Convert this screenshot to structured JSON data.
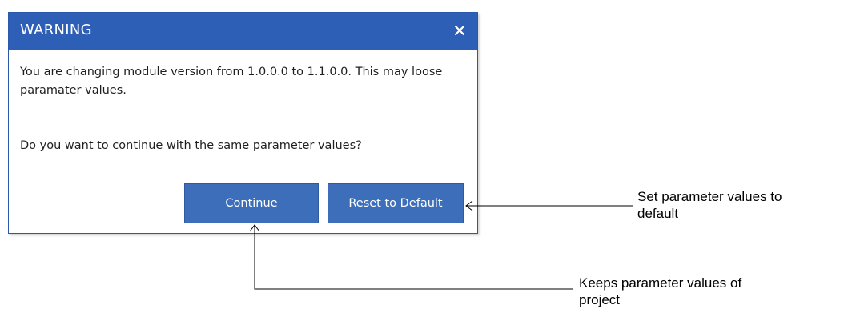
{
  "dialog": {
    "title": "WARNING",
    "message_line1": "You are changing module version from 1.0.0.0 to 1.1.0.0. This may loose paramater values.",
    "message_line2": "Do you want to continue with the same parameter values?",
    "buttons": {
      "continue_label": "Continue",
      "reset_label": "Reset to Default"
    },
    "close_icon": "close-icon",
    "colors": {
      "titlebar": "#2d5fb6",
      "button": "#3c6eb9",
      "border": "#2b58ab"
    }
  },
  "annotations": {
    "reset_note": "Set parameter values to\ndefault",
    "continue_note": "Keeps parameter values of\nproject"
  }
}
